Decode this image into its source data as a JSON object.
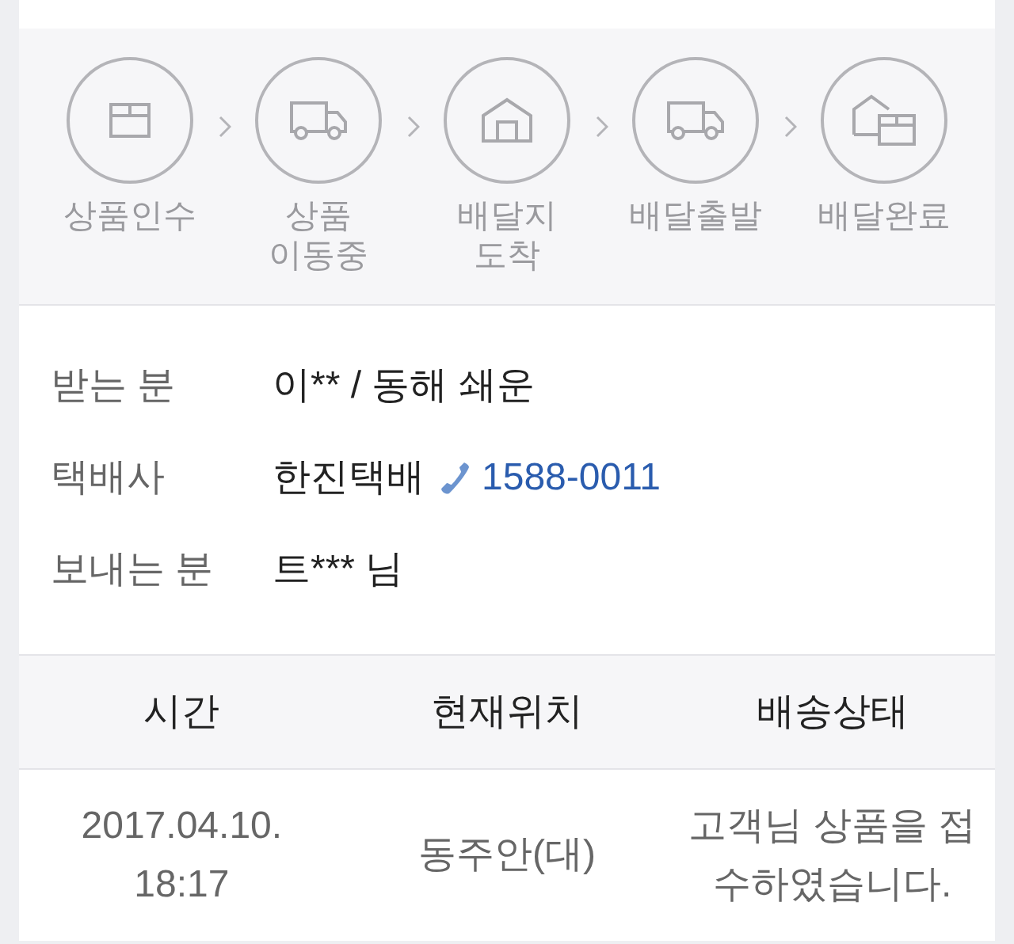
{
  "steps": [
    {
      "kind": "box",
      "label": "상품인수"
    },
    {
      "kind": "truck",
      "label": "상품\n이동중"
    },
    {
      "kind": "house",
      "label": "배달지\n도착"
    },
    {
      "kind": "truck",
      "label": "배달출발"
    },
    {
      "kind": "house-box",
      "label": "배달완료"
    }
  ],
  "info": [
    {
      "kind": "text",
      "label": "받는 분",
      "value": "이** / 동해 쇄운"
    },
    {
      "kind": "phone",
      "label": "택배사",
      "value": "한진택배",
      "phone": "1588-0011"
    },
    {
      "kind": "text",
      "label": "보내는 분",
      "value": "트*** 님"
    }
  ],
  "table": {
    "columns": [
      "시간",
      "현재위치",
      "배송상태"
    ],
    "rows": [
      [
        "2017.04.10.\n18:17",
        "동주안(대)",
        "고객님 상품을 접\n수하였습니다."
      ]
    ]
  }
}
